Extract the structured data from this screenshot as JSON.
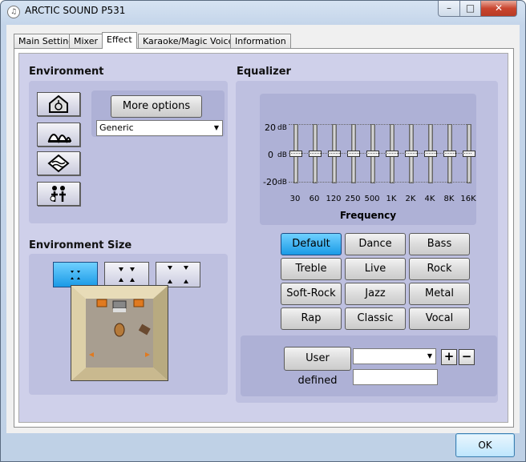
{
  "window": {
    "title": "ARCTIC SOUND P531",
    "minimize": "–",
    "maximize": "□",
    "close": "✕"
  },
  "tabs": [
    {
      "label": "Main Setting"
    },
    {
      "label": "Mixer"
    },
    {
      "label": "Effect"
    },
    {
      "label": "Karaoke/Magic Voice"
    },
    {
      "label": "Information"
    }
  ],
  "environment": {
    "heading": "Environment",
    "more_options": "More options",
    "selected": "Generic",
    "icons": [
      "concert-hall-icon",
      "opera-house-icon",
      "underwater-icon",
      "room-people-icon"
    ]
  },
  "environment_size": {
    "heading": "Environment Size",
    "selected_index": 0
  },
  "equalizer": {
    "heading": "Equalizer",
    "db_labels": [
      "20",
      "0",
      "-20"
    ],
    "db_unit": "dB",
    "frequencies": [
      "30",
      "60",
      "120",
      "250",
      "500",
      "1K",
      "2K",
      "4K",
      "8K",
      "16K"
    ],
    "levels_db": [
      0,
      0,
      0,
      0,
      0,
      0,
      0,
      0,
      0,
      0
    ],
    "axis_label": "Frequency",
    "presets": [
      "Default",
      "Dance",
      "Bass",
      "Treble",
      "Live",
      "Rock",
      "Soft-Rock",
      "Jazz",
      "Metal",
      "Rap",
      "Classic",
      "Vocal"
    ],
    "selected_preset": "Default",
    "user_defined": "User defined",
    "user_select_value": "",
    "name_value": "",
    "add": "+",
    "remove": "−"
  },
  "footer": {
    "ok": "OK"
  }
}
